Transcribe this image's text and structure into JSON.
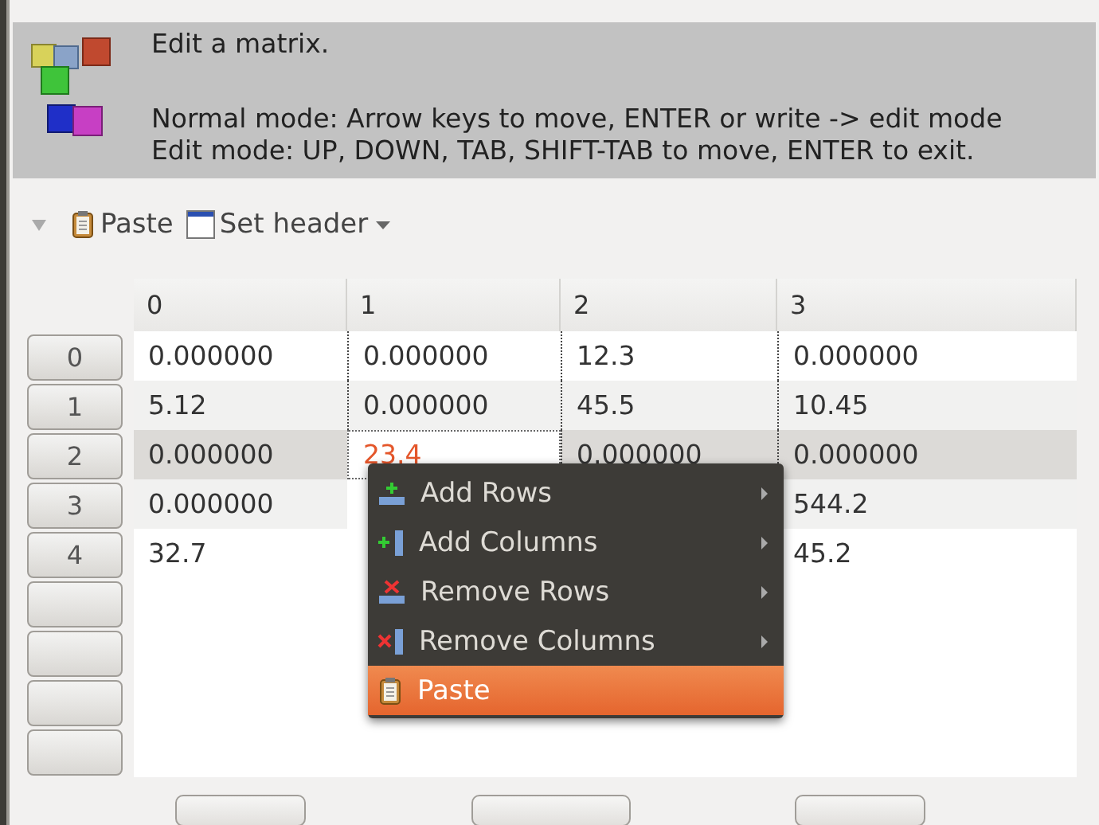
{
  "header": {
    "title": "Edit a matrix.",
    "lines": [
      "Normal mode: Arrow keys to move, ENTER or write -> edit mode",
      "Edit mode: UP, DOWN, TAB, SHIFT-TAB to move, ENTER to exit."
    ]
  },
  "toolbar": {
    "expanded": false,
    "items": [
      {
        "kind": "paste",
        "label": "Paste",
        "dropdown": false
      },
      {
        "kind": "header",
        "label": "Set header",
        "dropdown": true
      }
    ]
  },
  "table": {
    "columns": [
      "0",
      "1",
      "2",
      "3"
    ],
    "rows": [
      {
        "header": "0",
        "selected": false,
        "cells": [
          {
            "text": "0.000000",
            "focused": false
          },
          {
            "text": "0.000000",
            "focused": false
          },
          {
            "text": "12.3",
            "focused": false
          },
          {
            "text": "0.000000",
            "focused": false
          }
        ]
      },
      {
        "header": "1",
        "selected": false,
        "cells": [
          {
            "text": "5.12",
            "focused": false
          },
          {
            "text": "0.000000",
            "focused": false
          },
          {
            "text": "45.5",
            "focused": false
          },
          {
            "text": "10.45",
            "focused": false
          }
        ]
      },
      {
        "header": "2",
        "selected": true,
        "cells": [
          {
            "text": "0.000000",
            "focused": false
          },
          {
            "text": "23.4",
            "focused": true
          },
          {
            "text": "0.000000",
            "focused": false
          },
          {
            "text": "0.000000",
            "focused": false
          }
        ]
      },
      {
        "header": "3",
        "selected": false,
        "cells": [
          {
            "text": "0.000000",
            "focused": false
          },
          {},
          {},
          {
            "text": "544.2",
            "focused": false
          }
        ]
      },
      {
        "header": "4",
        "selected": false,
        "cells": [
          {
            "text": "32.7",
            "focused": false
          },
          {},
          {},
          {
            "text": "45.2",
            "focused": false
          }
        ]
      }
    ]
  },
  "context_menu": {
    "items": [
      {
        "kind": "add-rows",
        "label": "Add Rows",
        "submenu": true,
        "selected": false
      },
      {
        "kind": "add-columns",
        "label": "Add Columns",
        "submenu": true,
        "selected": false
      },
      {
        "kind": "remove-rows",
        "label": "Remove Rows",
        "submenu": true,
        "selected": false
      },
      {
        "kind": "remove-columns",
        "label": "Remove Columns",
        "submenu": true,
        "selected": false
      },
      {
        "kind": "paste",
        "label": "Paste",
        "submenu": false,
        "selected": true
      }
    ]
  }
}
